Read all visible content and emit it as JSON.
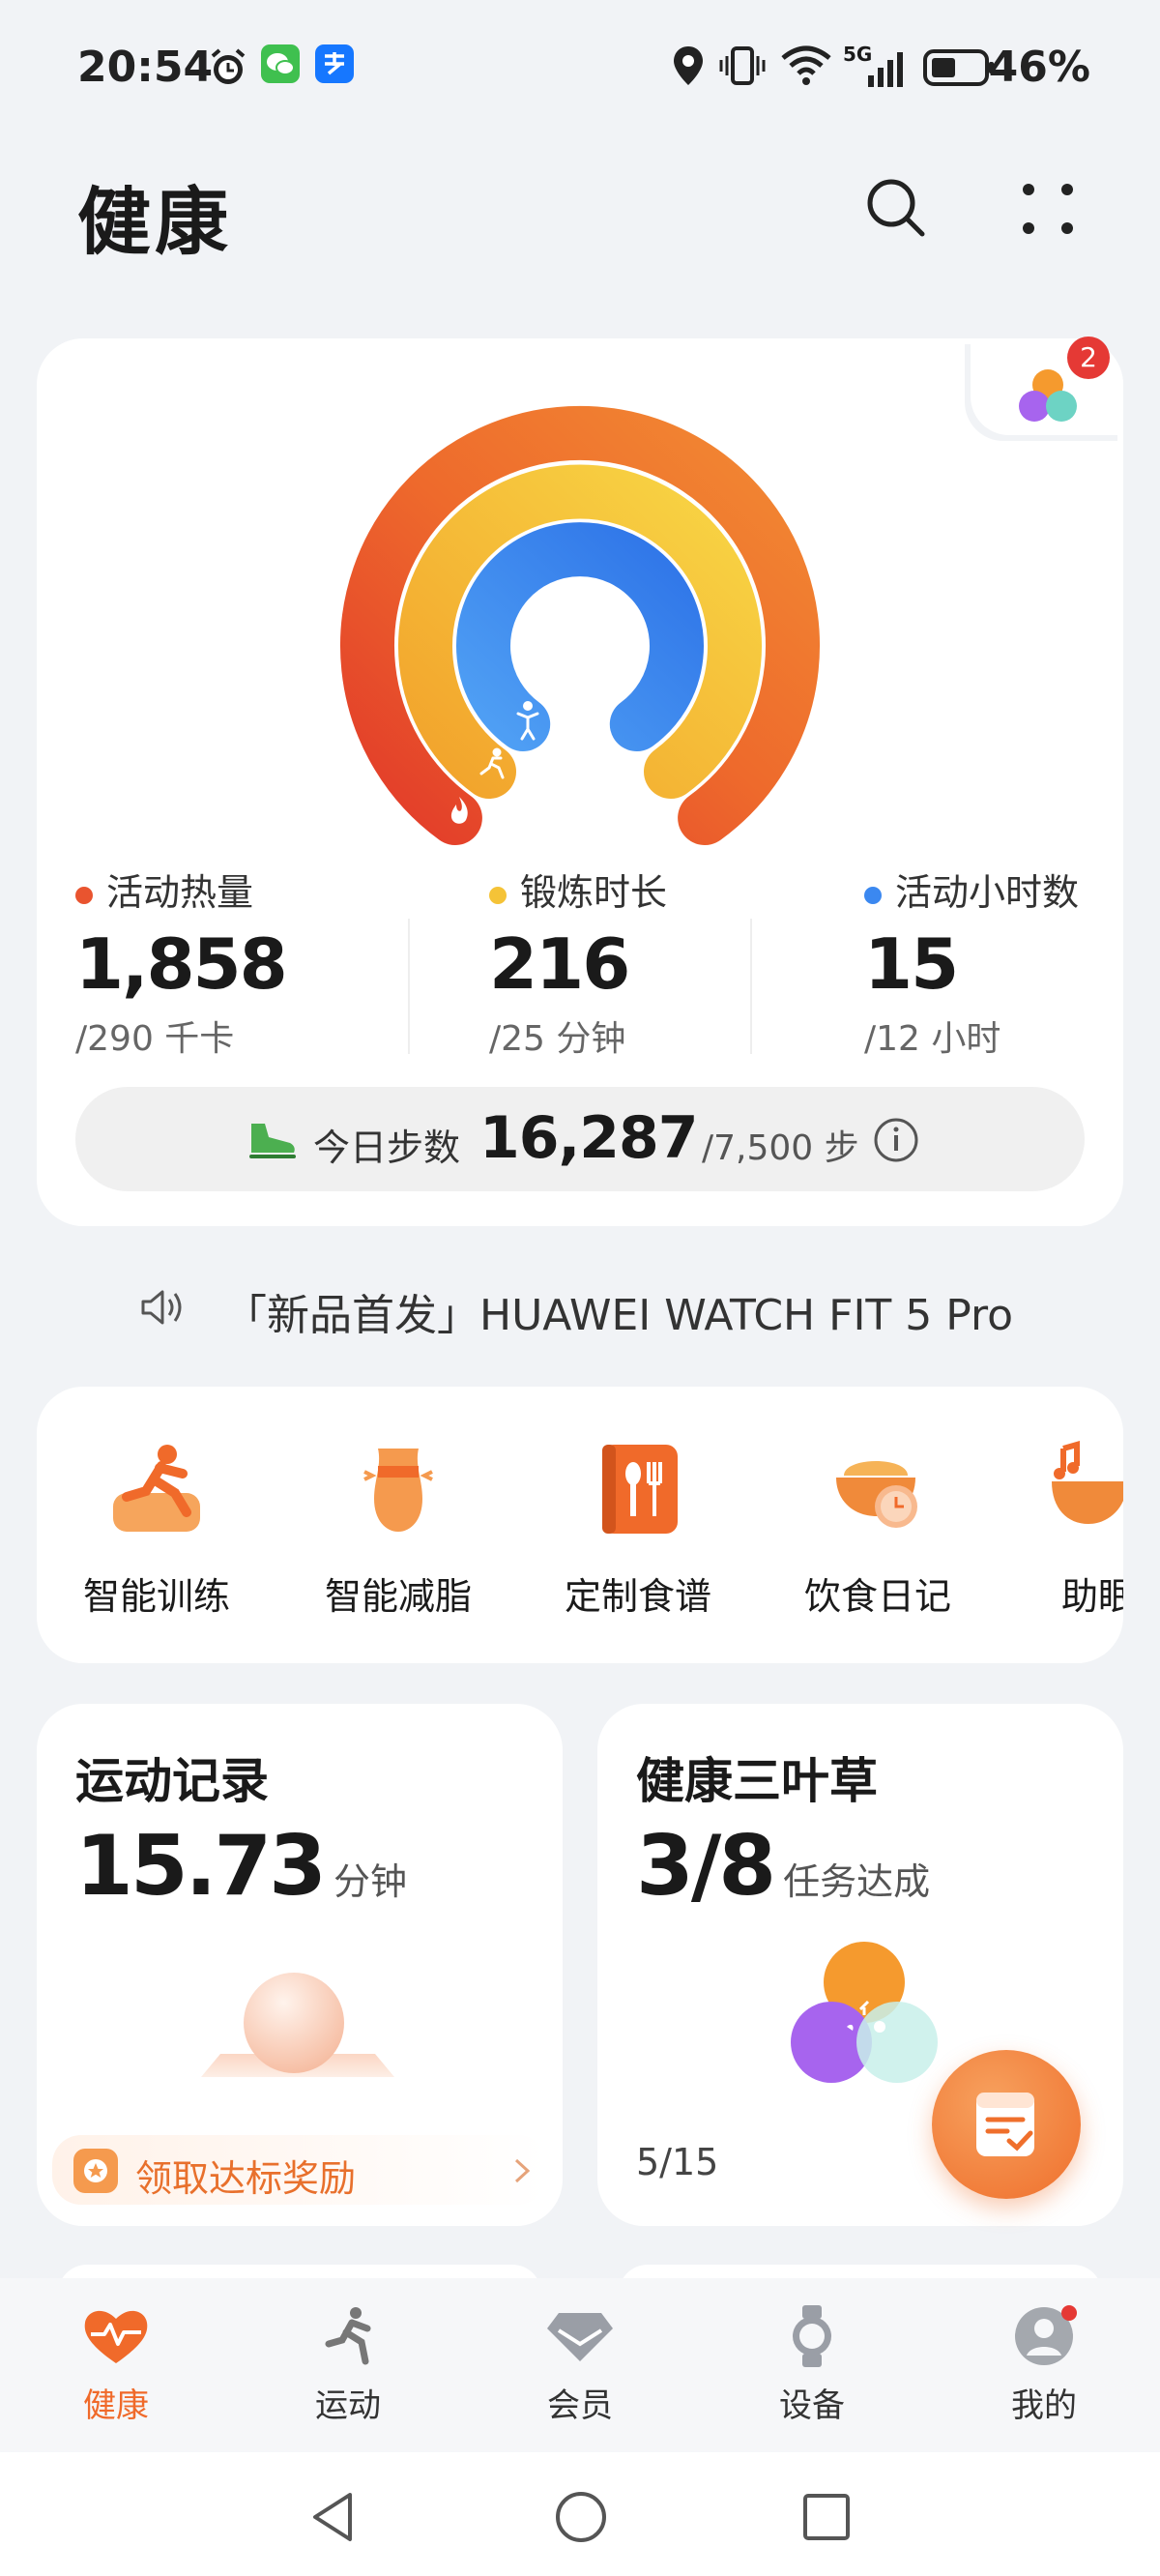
{
  "status_bar": {
    "time": "20:54",
    "network": "5G",
    "battery": "46%"
  },
  "header": {
    "title": "健康"
  },
  "activity": {
    "badge_count": "2",
    "rings": [
      {
        "name": "活动热量",
        "value": "1,858",
        "target": "/290 千卡",
        "color": "#e9542f"
      },
      {
        "name": "锻炼时长",
        "value": "216",
        "target": "/25 分钟",
        "color": "#f5c337"
      },
      {
        "name": "活动小时数",
        "value": "15",
        "target": "/12 小时",
        "color": "#3b88f0"
      }
    ],
    "steps_label": "今日步数",
    "steps_value": "16,287",
    "steps_target": "/7,500 步"
  },
  "promo": {
    "text": "「新品首发」HUAWEI WATCH FIT 5 Pro"
  },
  "quick_actions": [
    {
      "label": "智能训练",
      "icon": "smart-training-icon"
    },
    {
      "label": "智能减脂",
      "icon": "fat-loss-icon"
    },
    {
      "label": "定制食谱",
      "icon": "recipe-icon"
    },
    {
      "label": "饮食日记",
      "icon": "food-diary-icon"
    },
    {
      "label": "助眠",
      "icon": "sleep-aid-icon"
    }
  ],
  "exercise_card": {
    "title": "运动记录",
    "value": "15.73",
    "unit": "分钟",
    "reward_link": "领取达标奖励"
  },
  "clover_card": {
    "title": "健康三叶草",
    "value": "3/8",
    "unit": "任务达成",
    "progress": "5/15"
  },
  "tabs": [
    {
      "label": "健康",
      "active": true
    },
    {
      "label": "运动",
      "active": false
    },
    {
      "label": "会员",
      "active": false
    },
    {
      "label": "设备",
      "active": false
    },
    {
      "label": "我的",
      "active": false
    }
  ],
  "colors": {
    "accent": "#f06a2a",
    "background": "#f1f3f6"
  }
}
